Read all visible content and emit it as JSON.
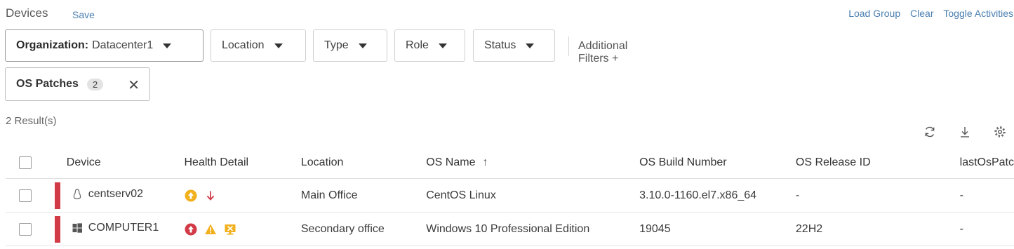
{
  "header": {
    "title": "Devices",
    "save_label": "Save",
    "actions": [
      "Load Group",
      "Clear",
      "Toggle Activities"
    ]
  },
  "filters": {
    "organization_key": "Organization:",
    "organization_value": "Datacenter1",
    "location": "Location",
    "type": "Type",
    "role": "Role",
    "status": "Status",
    "additional": "Additional Filters +"
  },
  "chip": {
    "label": "OS Patches",
    "count": "2"
  },
  "results_label": "2 Result(s)",
  "table": {
    "columns": [
      "Device",
      "Health Detail",
      "Location",
      "OS Name",
      "OS Build Number",
      "OS Release ID",
      "lastOsPatc"
    ],
    "rows": [
      {
        "device": "centserv02",
        "os_icon": "linux-icon",
        "health_icons": [
          "up-arrow-circle-icon",
          "down-arrow-icon"
        ],
        "location": "Main Office",
        "os_name": "CentOS Linux",
        "os_build": "3.10.0-1160.el7.x86_64",
        "os_release": "-",
        "last_patch": "-"
      },
      {
        "device": "COMPUTER1",
        "os_icon": "windows-icon",
        "health_icons": [
          "up-arrow-circle-icon",
          "warning-triangle-icon",
          "monitor-x-icon"
        ],
        "location": "Secondary office",
        "os_name": "Windows 10 Professional Edition",
        "os_build": "19045",
        "os_release": "22H2",
        "last_patch": "-"
      }
    ]
  },
  "colors": {
    "accent_link": "#4a7fb0",
    "severity": "#d23a46",
    "health_yellow": "#f2b01e",
    "health_red": "#d23a46"
  }
}
